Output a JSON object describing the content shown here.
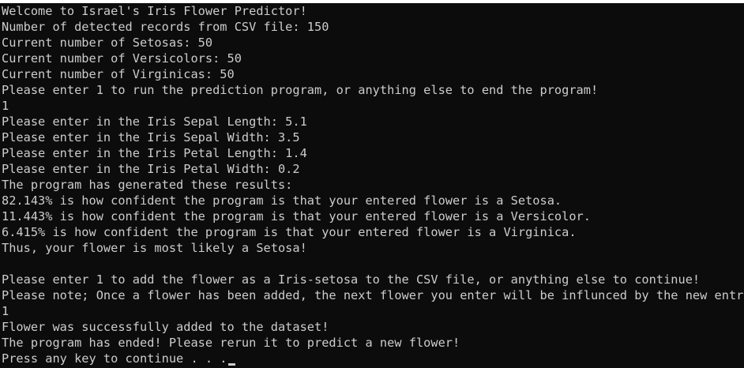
{
  "console": {
    "lines": [
      "Welcome to Israel's Iris Flower Predictor!",
      "Number of detected records from CSV file: 150",
      "Current number of Setosas: 50",
      "Current number of Versicolors: 50",
      "Current number of Virginicas: 50",
      "Please enter 1 to run the prediction program, or anything else to end the program!",
      "1",
      "Please enter in the Iris Sepal Length: 5.1",
      "Please enter in the Iris Sepal Width: 3.5",
      "Please enter in the Iris Petal Length: 1.4",
      "Please enter in the Iris Petal Width: 0.2",
      "The program has generated these results:",
      "82.143% is how confident the program is that your entered flower is a Setosa.",
      "11.443% is how confident the program is that your entered flower is a Versicolor.",
      "6.415% is how confident the program is that your entered flower is a Virginica.",
      "Thus, your flower is most likely a Setosa!",
      "",
      "Please enter 1 to add the flower as a Iris-setosa to the CSV file, or anything else to continue!",
      "Please note; Once a flower has been added, the next flower you enter will be influnced by the new entry!",
      "1",
      "Flower was successfully added to the dataset!",
      "The program has ended! Please rerun it to predict a new flower!",
      "Press any key to continue . . ."
    ]
  },
  "colors": {
    "background": "#0c0c0c",
    "text": "#cccccc"
  }
}
